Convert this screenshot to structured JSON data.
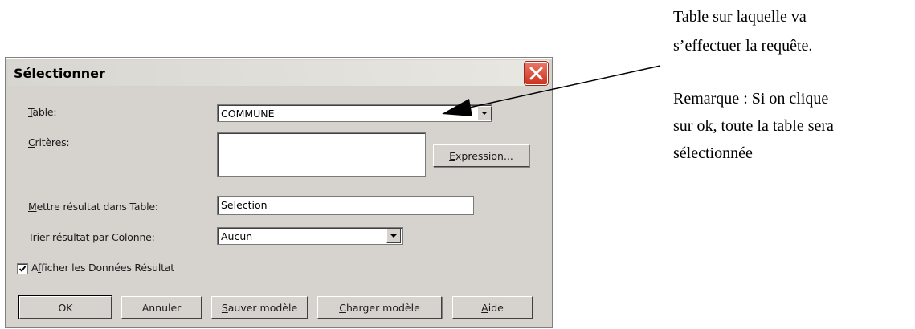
{
  "dialog": {
    "title": "Sélectionner",
    "table_label_first": "T",
    "table_label_rest": "able:",
    "table_value": "COMMUNE",
    "criteria_label_first": "C",
    "criteria_label_rest": "ritères:",
    "expression_button_first": "E",
    "expression_button_rest": "xpression...",
    "result_table_label_first": "M",
    "result_table_label_rest": "ettre résultat dans Table:",
    "result_table_value": "Selection",
    "sort_label_pre": "T",
    "sort_label_ul": "r",
    "sort_label_rest": "ier résultat par Colonne:",
    "sort_value": "Aucun",
    "show_data_checked": true,
    "show_data_pre": "A",
    "show_data_ul": "f",
    "show_data_rest": "ficher les Données Résultat",
    "buttons": {
      "ok": "OK",
      "cancel": "Annuler",
      "save_first": "S",
      "save_rest": "auver modèle",
      "load_first": "C",
      "load_rest": "harger modèle",
      "help_first": "A",
      "help_rest": "ide"
    }
  },
  "annotation": {
    "line1": "Table sur laquelle va",
    "line2": "s’effectuer la requête.",
    "line3": "Remarque : Si on clique",
    "line4": "sur ok, toute la table sera",
    "line5": "sélectionnée"
  },
  "icons": [
    "close-icon",
    "dropdown-arrow-icon",
    "checkmark-icon",
    "arrow-annotation"
  ]
}
